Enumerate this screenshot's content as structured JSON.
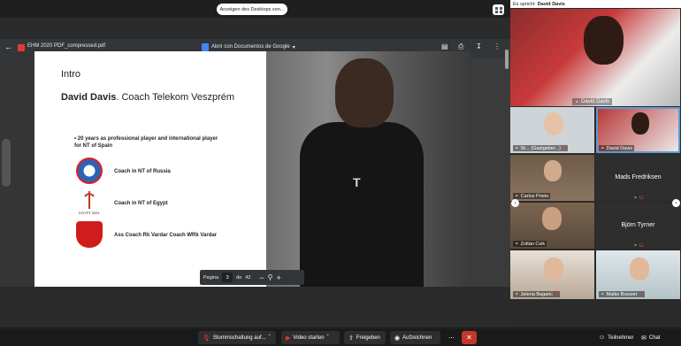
{
  "share": {
    "label": "Anzeigen des Desktops von..."
  },
  "pdf": {
    "title": "EHM 2020 PDF_compressed.pdf",
    "open_with": "Abrir con Documentos de Google",
    "page_label": "Pagina",
    "page_current": "3",
    "page_of": "de",
    "page_total": "42"
  },
  "slide": {
    "heading": "Intro",
    "name_bold": "David Davis",
    "name_rest": ". Coach Telekom Veszprém",
    "bullet": "20 years as professional player and international player for NT of Spain",
    "items": [
      "Coach in NT of Russia",
      "Coach in NT of Egypt",
      "Ass Coach Rk Vardar Coach WRk Vardar"
    ],
    "egypt_logo_text": "EGYPT 2021",
    "shirt_logo": "T"
  },
  "panel": {
    "speaking_prefix": "Es spricht:",
    "speaking_name": "David Davis",
    "main_name": "David Davis",
    "tiles": [
      {
        "name": "St...",
        "suffix": "(Gastgeber...)"
      },
      {
        "name": "David Davis"
      },
      {
        "name": "Carlos Prieto"
      },
      {
        "name": "Mads Fredriksen"
      },
      {
        "name": "Zoltán Csik"
      },
      {
        "name": "Björn Tyrner"
      },
      {
        "name": "Jelena Bagaric"
      },
      {
        "name": "Maike Bouwer"
      }
    ]
  },
  "toolbar": {
    "mute": "Stummschaltung auf...",
    "video": "Video starten",
    "share": "Freigeben",
    "record": "Aufzeichnen",
    "participants": "Teilnehmer",
    "chat": "Chat"
  },
  "colors": {
    "end_call": "#c4372c",
    "active_border": "#5b9bd5",
    "mic_off": "#e53935"
  }
}
